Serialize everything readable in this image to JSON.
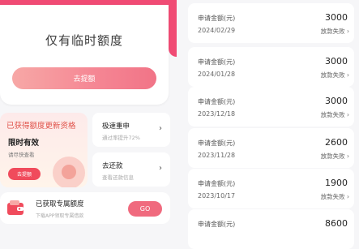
{
  "quota": {
    "title": "仅有临时额度",
    "button": "去提额"
  },
  "promo": {
    "title": "已获得额度更新资格",
    "subtitle": "限时有效",
    "desc": "请尽快查看",
    "button": "去提额"
  },
  "tiles": [
    {
      "title": "极速重申",
      "desc": "通过率提升72%"
    },
    {
      "title": "去还款",
      "desc": "查看还款信息"
    }
  ],
  "exclusive": {
    "title": "已获取专属额度",
    "desc": "下载APP领取专属借款",
    "button": "GO"
  },
  "records": [
    {
      "label": "申请金额(元)",
      "date": "2024/02/29",
      "amount": "3000",
      "status": "放款失败 ›"
    },
    {
      "label": "申请金额(元)",
      "date": "2024/01/28",
      "amount": "3000",
      "status": "放款失败 ›"
    },
    {
      "label": "申请金额(元)",
      "date": "2023/12/18",
      "amount": "3000",
      "status": "放款失败 ›"
    },
    {
      "label": "申请金额(元)",
      "date": "2023/11/28",
      "amount": "2600",
      "status": "放款失败 ›"
    },
    {
      "label": "申请金额(元)",
      "date": "2023/10/17",
      "amount": "1900",
      "status": "放款失败 ›"
    },
    {
      "label": "申请金额(元)",
      "date": "",
      "amount": "8600",
      "status": ""
    }
  ],
  "icons": {
    "chevron": "›",
    "wallet": "wallet-icon"
  },
  "colors": {
    "accent": "#f04b74",
    "button_gradient_start": "#f7a8a6",
    "button_gradient_end": "#f17487"
  }
}
